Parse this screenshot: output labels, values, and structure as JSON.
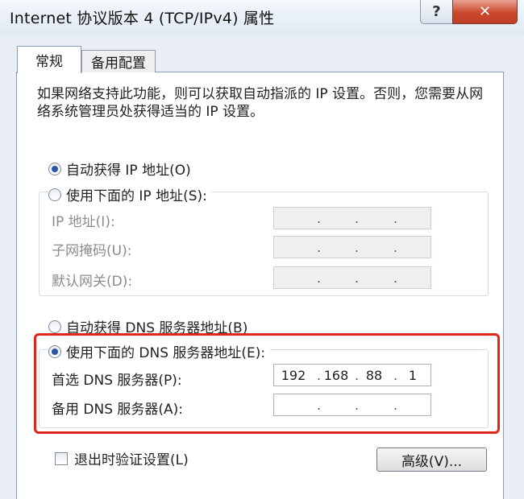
{
  "window": {
    "title": "Internet 协议版本 4 (TCP/IPv4) 属性",
    "help_label": "?",
    "close_label": "✕"
  },
  "tabs": [
    {
      "label": "常规",
      "active": true
    },
    {
      "label": "备用配置",
      "active": false
    }
  ],
  "description": "如果网络支持此功能，则可以获取自动指派的 IP 设置。否则，您需要从网络系统管理员处获得适当的 IP 设置。",
  "ip_section": {
    "auto_label": "自动获得 IP 地址(O)",
    "auto_selected": true,
    "manual_label": "使用下面的 IP 地址(S):",
    "manual_selected": false,
    "fields": [
      {
        "label": "IP 地址(I):",
        "octets": [
          "",
          "",
          "",
          ""
        ]
      },
      {
        "label": "子网掩码(U):",
        "octets": [
          "",
          "",
          "",
          ""
        ]
      },
      {
        "label": "默认网关(D):",
        "octets": [
          "",
          "",
          "",
          ""
        ]
      }
    ]
  },
  "dns_section": {
    "auto_label": "自动获得 DNS 服务器地址(B)",
    "auto_selected": false,
    "manual_label": "使用下面的 DNS 服务器地址(E):",
    "manual_selected": true,
    "preferred": {
      "label": "首选 DNS 服务器(P):",
      "octets": [
        "192",
        "168",
        "88",
        "1"
      ]
    },
    "alternate": {
      "label": "备用 DNS 服务器(A):",
      "octets": [
        "",
        "",
        "",
        ""
      ]
    }
  },
  "validate_checkbox": {
    "label": "退出时验证设置(L)",
    "checked": false
  },
  "advanced_button": "高级(V)...",
  "colors": {
    "highlight_frame": "#e0271b",
    "radio_dot": "#2b56a8"
  }
}
